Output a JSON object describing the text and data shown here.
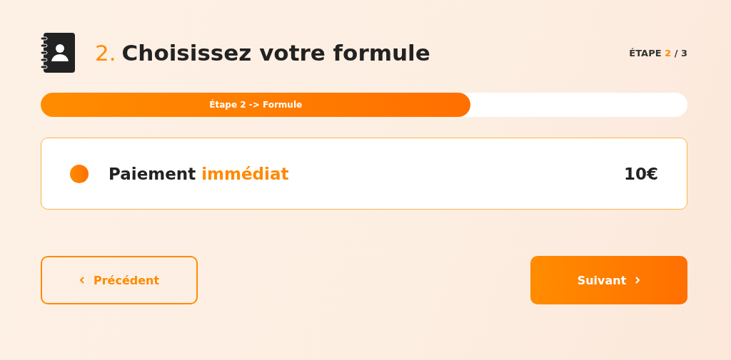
{
  "header": {
    "number": "2.",
    "title": "Choisissez votre formule"
  },
  "step": {
    "label": "ÉTAPE",
    "current": "2",
    "total": "/ 3"
  },
  "progress": {
    "label": "Étape 2 -> Formule",
    "level": 0.665
  },
  "options": [
    {
      "name": "Paiement",
      "highlight": "immédiat",
      "price": "10€",
      "selected": true
    }
  ],
  "buttons": [
    {
      "kind": "back",
      "label": "Précédent"
    },
    {
      "kind": "next",
      "label": "Suivant"
    }
  ]
}
